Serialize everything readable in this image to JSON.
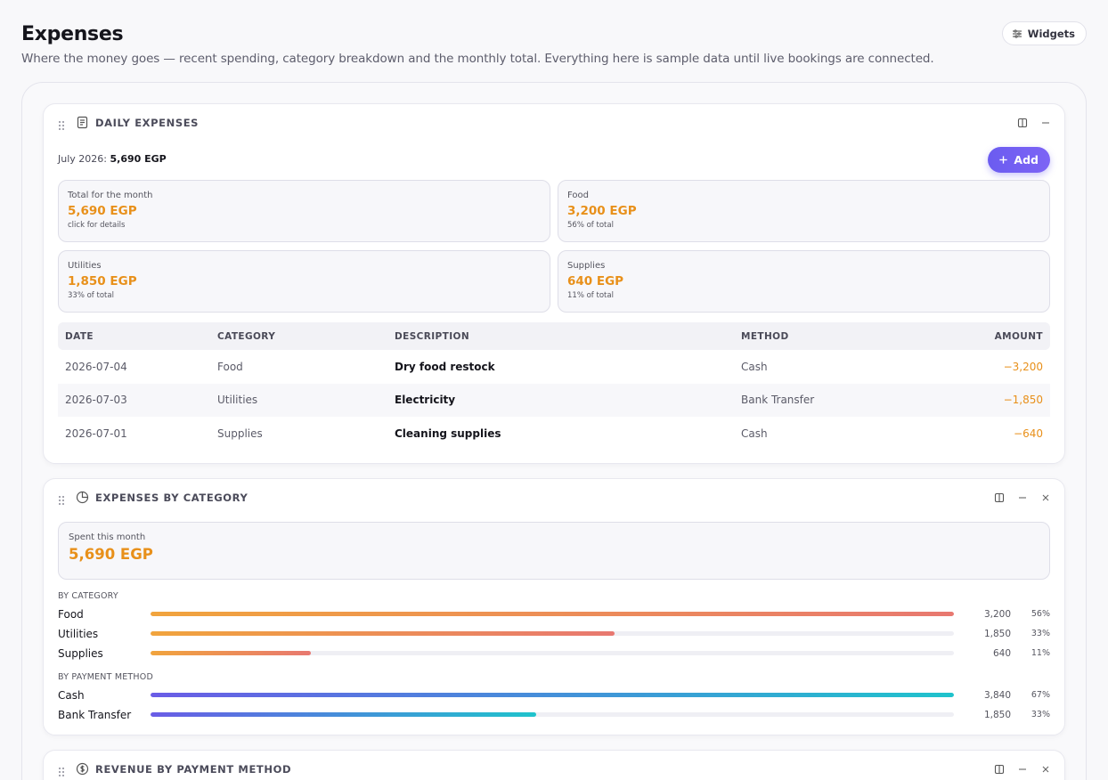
{
  "header": {
    "title": "Expenses",
    "subtitle": "Where the money goes — recent spending, category breakdown and the monthly total. Everything here is sample data until live bookings are connected.",
    "widgets_label": "Widgets"
  },
  "daily": {
    "title": "DAILY EXPENSES",
    "month_label": "July 2026:",
    "month_total": "5,690 EGP",
    "add_label": "Add",
    "stats": [
      {
        "label": "Total for the month",
        "value": "5,690 EGP",
        "sub": "click for details"
      },
      {
        "label": "Food",
        "value": "3,200 EGP",
        "sub": "56% of total"
      },
      {
        "label": "Utilities",
        "value": "1,850 EGP",
        "sub": "33% of total"
      },
      {
        "label": "Supplies",
        "value": "640 EGP",
        "sub": "11% of total"
      }
    ],
    "columns": {
      "date": "DATE",
      "category": "CATEGORY",
      "description": "DESCRIPTION",
      "method": "METHOD",
      "amount": "AMOUNT"
    },
    "rows": [
      {
        "date": "2026-07-04",
        "category": "Food",
        "description": "Dry food restock",
        "method": "Cash",
        "amount": "−3,200"
      },
      {
        "date": "2026-07-03",
        "category": "Utilities",
        "description": "Electricity",
        "method": "Bank Transfer",
        "amount": "−1,850"
      },
      {
        "date": "2026-07-01",
        "category": "Supplies",
        "description": "Cleaning supplies",
        "method": "Cash",
        "amount": "−640"
      }
    ]
  },
  "by_category": {
    "title": "EXPENSES BY CATEGORY",
    "spent_label": "Spent this month",
    "spent_value": "5,690 EGP",
    "category_heading": "BY CATEGORY",
    "categories": [
      {
        "name": "Food",
        "value": "3,200",
        "pct": "56%",
        "fill": 1.0
      },
      {
        "name": "Utilities",
        "value": "1,850",
        "pct": "33%",
        "fill": 0.578
      },
      {
        "name": "Supplies",
        "value": "640",
        "pct": "11%",
        "fill": 0.2
      }
    ],
    "method_heading": "BY PAYMENT METHOD",
    "methods": [
      {
        "name": "Cash",
        "value": "3,840",
        "pct": "67%",
        "fill": 1.0
      },
      {
        "name": "Bank Transfer",
        "value": "1,850",
        "pct": "33%",
        "fill": 0.48
      }
    ]
  },
  "revenue": {
    "title": "REVENUE BY PAYMENT METHOD"
  },
  "colors": {
    "accent": "#6b5cf0",
    "amount": "#e8901a",
    "warm_bar": [
      "#f1a43d",
      "#e87870"
    ],
    "cool_bar": [
      "#6a5ce6",
      "#1fc3cc"
    ]
  }
}
